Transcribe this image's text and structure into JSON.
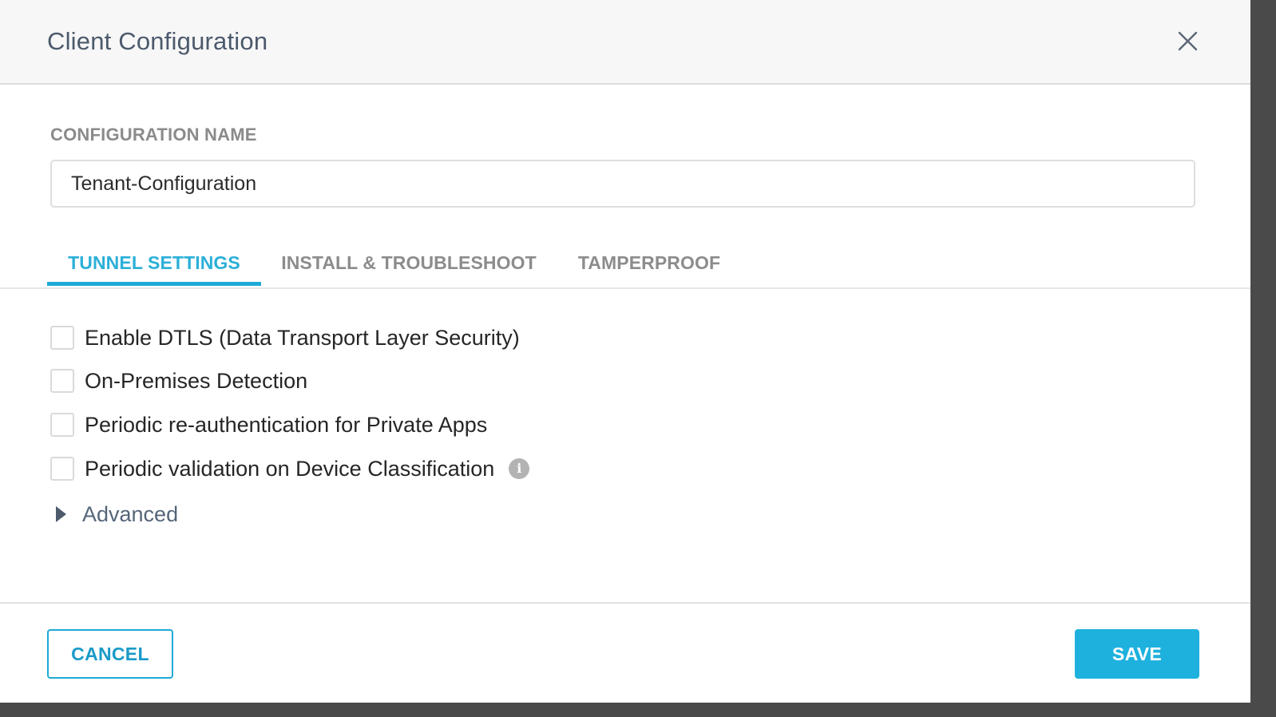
{
  "modal": {
    "title": "Client Configuration"
  },
  "configuration": {
    "label": "CONFIGURATION NAME",
    "value": "Tenant-Configuration"
  },
  "tabs": [
    {
      "label": "TUNNEL SETTINGS",
      "active": true
    },
    {
      "label": "INSTALL & TROUBLESHOOT",
      "active": false
    },
    {
      "label": "TAMPERPROOF",
      "active": false
    }
  ],
  "options": [
    {
      "label": "Enable DTLS (Data Transport Layer Security)",
      "checked": false
    },
    {
      "label": "On-Premises Detection",
      "checked": false
    },
    {
      "label": "Periodic re-authentication for Private Apps",
      "checked": false
    },
    {
      "label": "Periodic validation on Device Classification",
      "checked": false,
      "info_icon": "info-icon"
    }
  ],
  "advanced": {
    "label": "Advanced",
    "expanded": false,
    "icon": "caret-right-icon"
  },
  "footer": {
    "cancel_label": "CANCEL",
    "save_label": "SAVE"
  },
  "colors": {
    "accent": "#1eaad6",
    "title_text": "#4c5a6c",
    "muted_label": "#8b8b8b"
  },
  "icons": {
    "close": "close-icon",
    "info": "info-icon"
  }
}
